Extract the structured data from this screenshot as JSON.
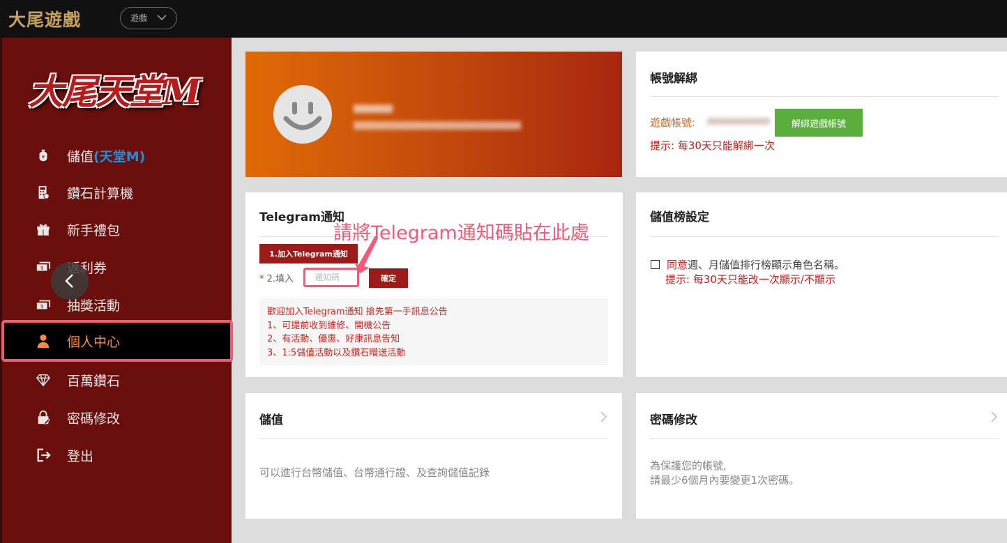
{
  "topbar": {
    "brand": "大尾遊戲",
    "game_select": "遊戲"
  },
  "sidebar": {
    "logo_text": "大尾天堂M",
    "items": [
      {
        "label": "儲值",
        "highlight": "(天堂M)",
        "icon": "money-bag-icon"
      },
      {
        "label": "鑽石計算機",
        "icon": "calculator-icon"
      },
      {
        "label": "新手禮包",
        "icon": "gift-icon"
      },
      {
        "label": "返利券",
        "icon": "coupon-icon"
      },
      {
        "label": "抽獎活動",
        "icon": "lottery-icon"
      },
      {
        "label": "個人中心",
        "icon": "user-icon",
        "active": true
      },
      {
        "label": "百萬鑽石",
        "icon": "diamond-icon"
      },
      {
        "label": "密碼修改",
        "icon": "lock-edit-icon"
      },
      {
        "label": "登出",
        "icon": "logout-icon"
      }
    ]
  },
  "account_unbind": {
    "title": "帳號解綁",
    "account_label": "遊戲帳號:",
    "unbind_button": "解綁遊戲帳號",
    "hint": "提示: 每30天只能解綁一次"
  },
  "telegram": {
    "title": "Telegram通知",
    "join_button": "1.加入Telegram通知",
    "required_mark": "*",
    "fill_label": "2.填入",
    "code_placeholder": "通知碼",
    "confirm_button": "確定",
    "annotation": "請將Telegram通知碼貼在此處",
    "notice_lines": [
      "歡迎加入Telegram通知 搶先第一手訊息公告",
      "1、可提前收到維修、開機公告",
      "2、有活動、優惠、好康訊息告知",
      "3、1:5儲值活動以及鑽石贈送活動"
    ]
  },
  "ranking": {
    "title": "儲值榜設定",
    "agree_word": "同意",
    "agree_rest": "週、月儲值排行榜顯示角色名稱。",
    "hint": "提示: 每30天只能改一次顯示/不顯示"
  },
  "deposit": {
    "title": "儲值",
    "desc": "可以進行台幣儲值、台幣通行證、及查詢儲值記錄"
  },
  "password": {
    "title": "密碼修改",
    "desc_line1": "為保護您的帳號,",
    "desc_line2": "請最少6個月內要變更1次密碼。"
  },
  "colors": {
    "sidebar_bg": "#6b0f0c",
    "active_text": "#ff8a3d",
    "highlight_blue": "#1d8fe0",
    "green_button": "#5aae3c",
    "dark_red_button": "#9c1b18",
    "annotation_pink": "#f25a78",
    "hint_red": "#c81c1c"
  }
}
